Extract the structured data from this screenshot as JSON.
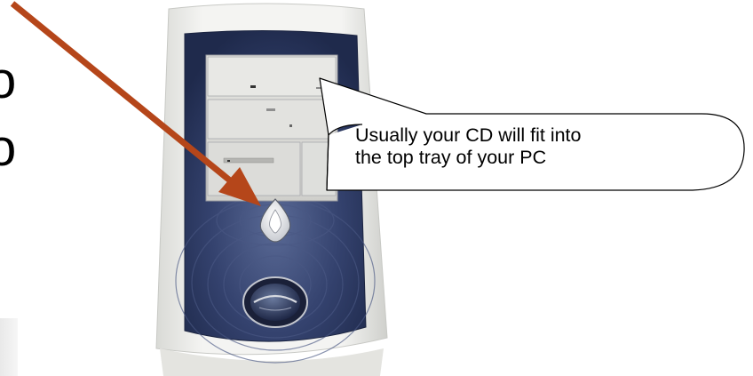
{
  "callout": {
    "line1": "Usually your CD will fit into",
    "line2": "the top tray of your PC"
  },
  "edge_text": {
    "glyph1": "o",
    "glyph2": "o"
  },
  "colors": {
    "arrow": "#b5461a",
    "tower_bezel": "#2c3a66",
    "tower_shell": "#ecedea",
    "callout_border": "#000000"
  },
  "icons": {
    "arrow": "arrow-icon",
    "power_button": "power-button-icon",
    "logo": "logo-badge-icon"
  }
}
